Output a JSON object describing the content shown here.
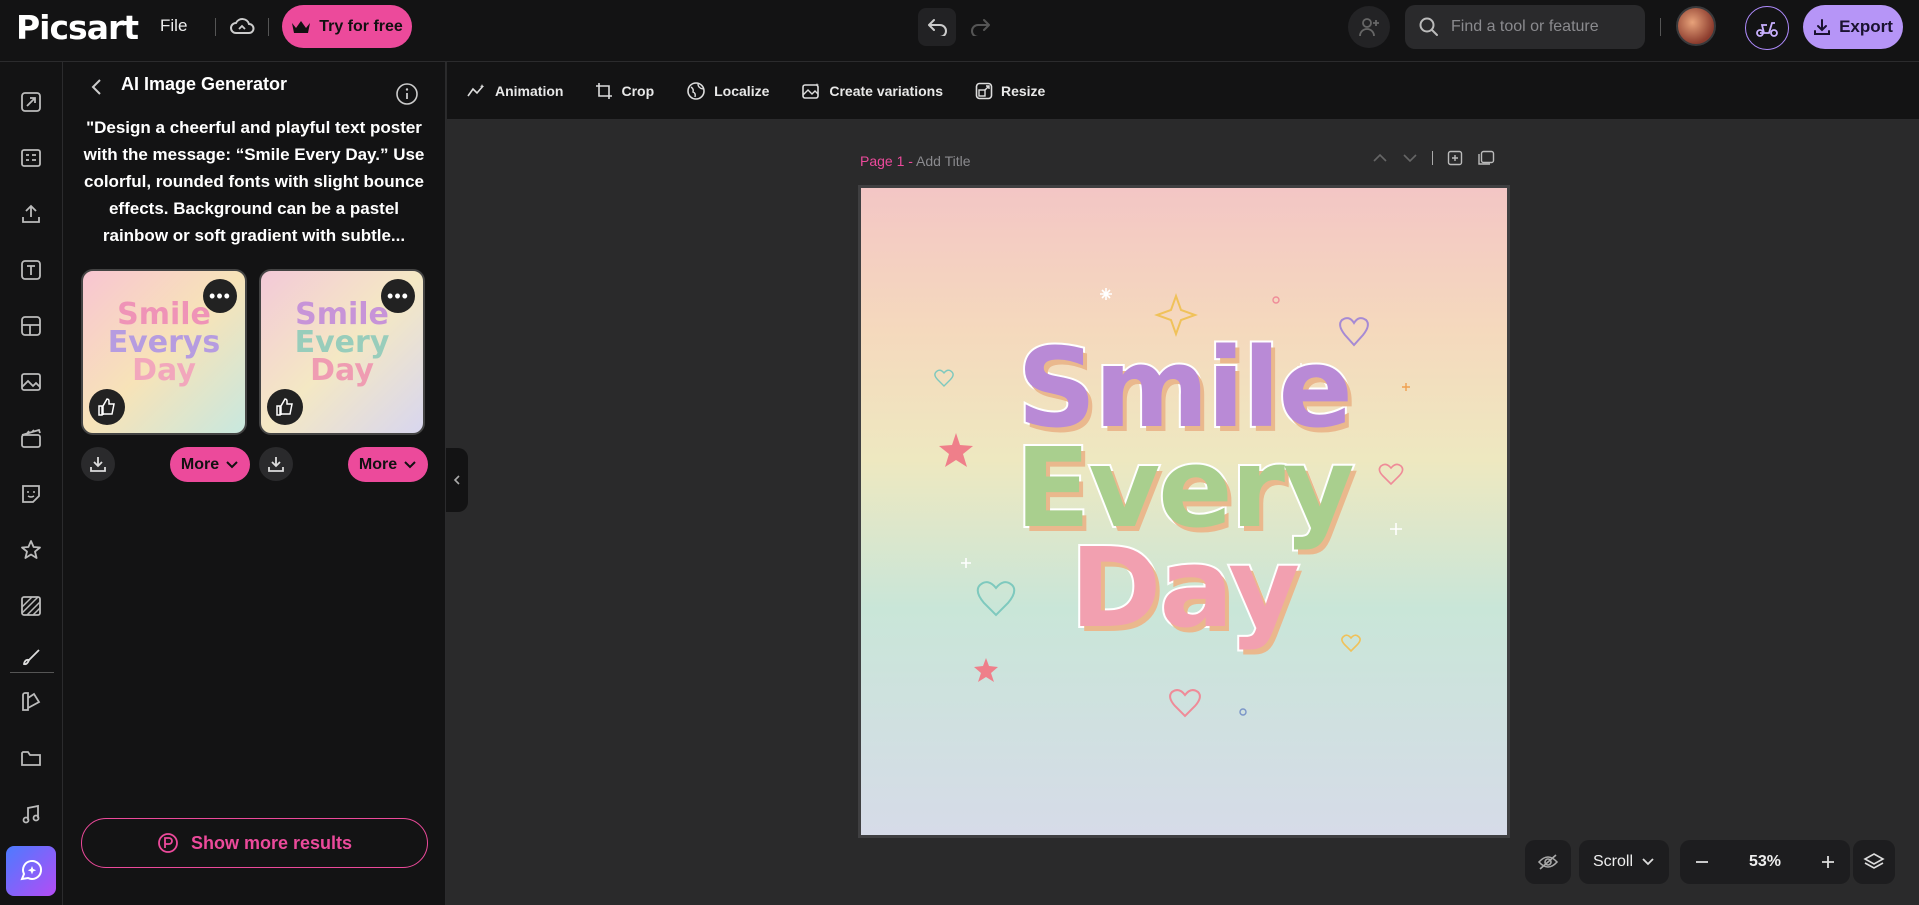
{
  "header": {
    "logo": "Picsart",
    "file_label": "File",
    "try_label": "Try for free",
    "search_placeholder": "Find a tool or feature",
    "export_label": "Export"
  },
  "toolbar": {
    "tools": [
      "Animation",
      "Crop",
      "Localize",
      "Create variations",
      "Resize"
    ]
  },
  "panel": {
    "title": "AI Image Generator",
    "prompt": "\"Design a cheerful and playful text poster with the message: “Smile Every Day.” Use colorful, rounded fonts with slight bounce effects. Background can be a pastel rainbow or soft gradient with subtle...",
    "results": [
      {
        "text_lines": [
          "Smile",
          "Everys",
          "Day"
        ]
      },
      {
        "text_lines": [
          "Smile",
          "Every",
          "Day"
        ]
      }
    ],
    "more_label": "More",
    "show_more_label": "Show more results"
  },
  "canvas": {
    "page_num": "Page 1",
    "page_sep": " - ",
    "page_title_placeholder": "Add Title",
    "poster_lines": [
      "Smile",
      "Every",
      "Day"
    ]
  },
  "bottom": {
    "scroll_label": "Scroll",
    "zoom": "53%"
  },
  "colors": {
    "accent_pink": "#ec4a9b",
    "export_purple": "#b695f7",
    "panel_bg": "#131314",
    "canvas_bg": "#2a2a2b"
  }
}
